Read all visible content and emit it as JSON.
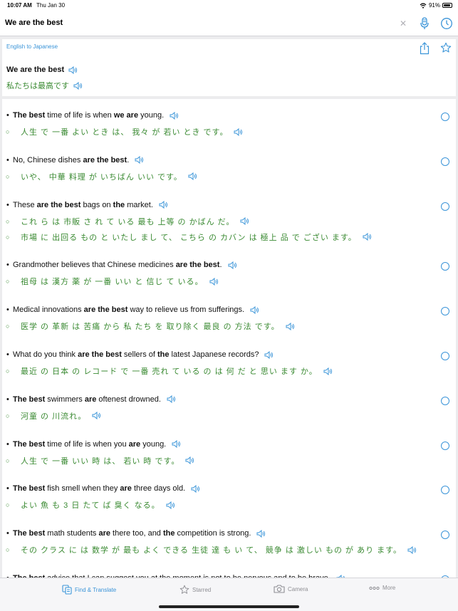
{
  "status": {
    "time": "10:07 AM",
    "date": "Thu Jan 30",
    "battery": "91%"
  },
  "search": {
    "query": "We are the best"
  },
  "header": {
    "direction": "English to Japanese",
    "source_phrase": "We are the best",
    "target_phrase": "私たちは最高です"
  },
  "results": [
    {
      "en": [
        [
          "b",
          "The best"
        ],
        [
          "t",
          " time of life is when "
        ],
        [
          "b",
          "we are"
        ],
        [
          "t",
          " young."
        ]
      ],
      "ja": "人生 で 一番 よい とき は、 我々 が 若い とき です。"
    },
    {
      "en": [
        [
          "t",
          "No, Chinese dishes "
        ],
        [
          "b",
          "are the best"
        ],
        [
          "t",
          "."
        ]
      ],
      "ja": "いや、 中華 料理 が いちばん いい です。"
    },
    {
      "en": [
        [
          "t",
          "These "
        ],
        [
          "b",
          "are the best"
        ],
        [
          "t",
          " bags on "
        ],
        [
          "b",
          "the"
        ],
        [
          "t",
          " market."
        ]
      ],
      "ja": "これ ら は 市販 さ れ て いる 最も 上等 の かばん だ。",
      "ja2": "市場 に 出回る もの と いたし まし て、 こちら の カバン は 極上 品 で ござい ます。"
    },
    {
      "en": [
        [
          "t",
          "Grandmother believes that Chinese medicines "
        ],
        [
          "b",
          "are the best"
        ],
        [
          "t",
          "."
        ]
      ],
      "ja": "祖母 は 漢方 薬 が 一番 いい と 信じ て いる。"
    },
    {
      "en": [
        [
          "t",
          "Medical innovations "
        ],
        [
          "b",
          "are the best"
        ],
        [
          "t",
          " way to relieve us from sufferings."
        ]
      ],
      "ja": "医学 の 革新 は 苦痛 から 私 たち を 取り除く 最良 の 方法 です。"
    },
    {
      "en": [
        [
          "t",
          "What do you think "
        ],
        [
          "b",
          "are the best"
        ],
        [
          "t",
          " sellers of "
        ],
        [
          "b",
          "the"
        ],
        [
          "t",
          " latest Japanese records?"
        ]
      ],
      "ja": "最近 の 日本 の レコード で 一番 売れ て いる の は 何 だ と 思い ます か。"
    },
    {
      "en": [
        [
          "b",
          "The best"
        ],
        [
          "t",
          " swimmers "
        ],
        [
          "b",
          "are"
        ],
        [
          "t",
          " oftenest drowned."
        ]
      ],
      "ja": "河童 の 川流れ。"
    },
    {
      "en": [
        [
          "b",
          "The best"
        ],
        [
          "t",
          " time of life is when you "
        ],
        [
          "b",
          "are"
        ],
        [
          "t",
          " young."
        ]
      ],
      "ja": "人生 で 一番 いい 時 は、 若い 時 です。"
    },
    {
      "en": [
        [
          "b",
          "The best"
        ],
        [
          "t",
          " fish smell when they "
        ],
        [
          "b",
          "are"
        ],
        [
          "t",
          " three days old."
        ]
      ],
      "ja": "よい 魚 も 3 日 たて ば 臭く なる。"
    },
    {
      "en": [
        [
          "b",
          "The best"
        ],
        [
          "t",
          " math students "
        ],
        [
          "b",
          "are"
        ],
        [
          "t",
          " there too, and "
        ],
        [
          "b",
          "the"
        ],
        [
          "t",
          " competition is strong."
        ]
      ],
      "ja": "その クラス に は 数学 が 最も よく できる 生徒 達 も い て、 競争 は 激しい もの が あり ます。"
    },
    {
      "en": [
        [
          "b",
          "The best"
        ],
        [
          "t",
          " advice that I can suggest you at the moment is not to be nervous and to be brave."
        ]
      ],
      "ja": ""
    }
  ],
  "tabs": [
    {
      "label": "Find & Translate",
      "icon": "dictionary-icon",
      "active": true
    },
    {
      "label": "Starred",
      "icon": "star-icon"
    },
    {
      "label": "Camera",
      "icon": "camera-icon"
    },
    {
      "label": "More",
      "icon": "more-icon"
    }
  ],
  "colors": {
    "accent": "#3a94d8",
    "japanese_text": "#3a8a32",
    "background": "#ececee"
  }
}
